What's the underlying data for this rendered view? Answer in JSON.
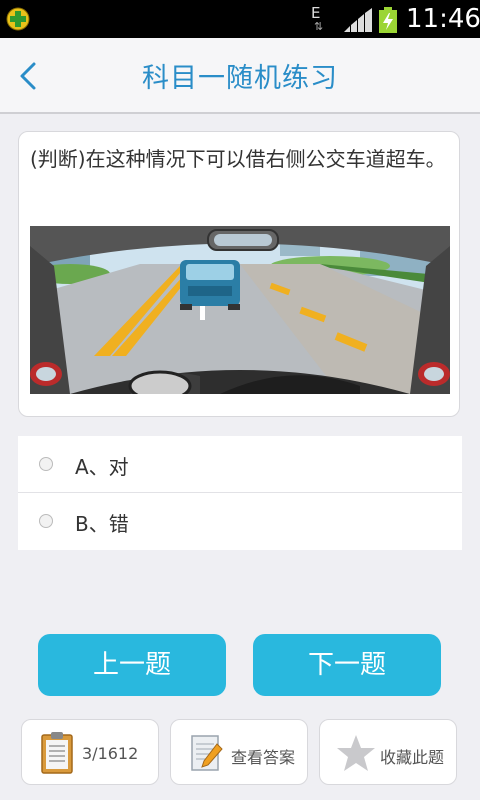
{
  "status_bar": {
    "network_indicator": "E",
    "time": "11:46"
  },
  "header": {
    "title": "科目一随机练习"
  },
  "question": {
    "text": "(判断)在这种情况下可以借右侧公交车道超车。"
  },
  "options": [
    {
      "label": "A、对"
    },
    {
      "label": "B、错"
    }
  ],
  "navigation": {
    "prev_label": "上一题",
    "next_label": "下一题"
  },
  "toolbar": {
    "progress": "3/1612",
    "view_answer_label": "查看答案",
    "favorite_label": "收藏此题"
  },
  "colors": {
    "accent": "#29b8de",
    "title": "#2a8dc8",
    "background": "#efeff3"
  },
  "icons": {
    "back": "chevron-left-icon",
    "progress": "clipboard-icon",
    "answer": "notepad-pencil-icon",
    "favorite": "star-icon"
  }
}
